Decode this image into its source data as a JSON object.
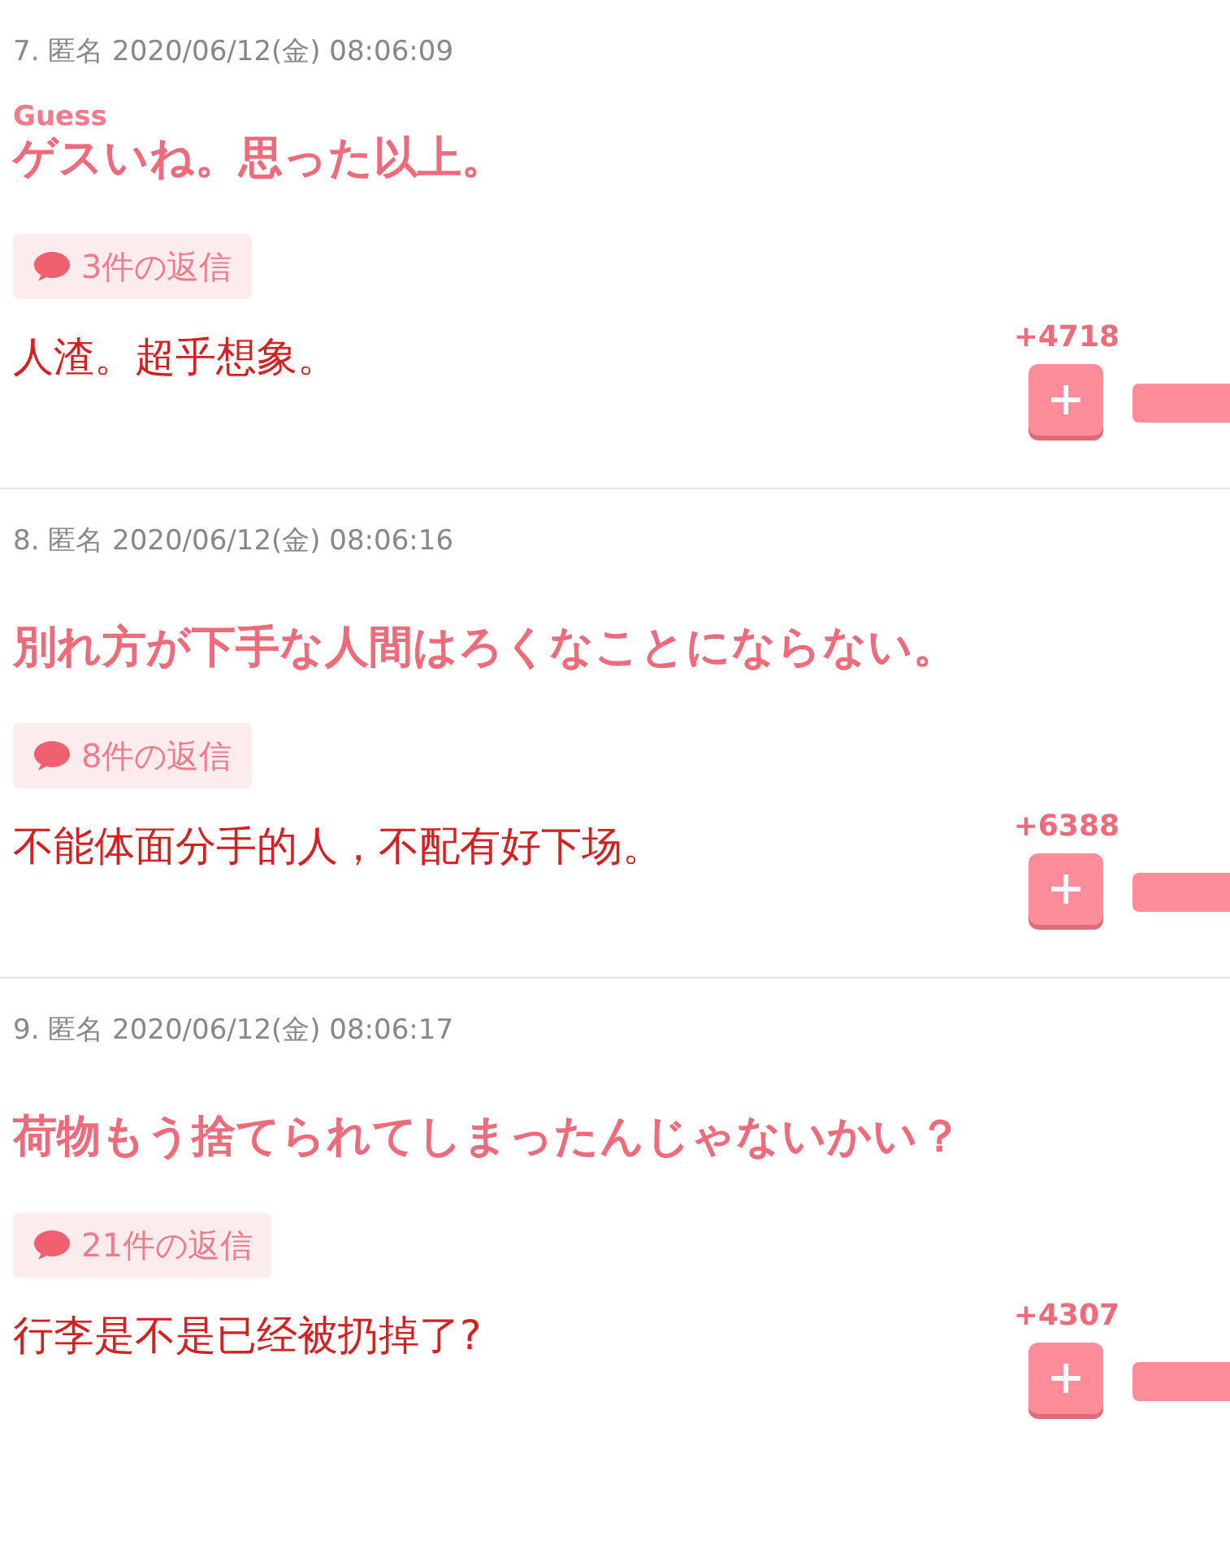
{
  "comments": [
    {
      "meta": "7. 匿名 2020/06/12(金) 08:06:09",
      "ruby": "Guess",
      "headline": "ゲスいね。思った以上。",
      "replies": "3件の返信",
      "translation": "人渣。超乎想象。",
      "votes": "+4718"
    },
    {
      "meta": "8. 匿名 2020/06/12(金) 08:06:16",
      "headline": "別れ方が下手な人間はろくなことにならない。",
      "replies": "8件の返信",
      "translation": "不能体面分手的人，不配有好下场。",
      "votes": "+6388"
    },
    {
      "meta": "9. 匿名 2020/06/12(金) 08:06:17",
      "headline": "荷物もう捨てられてしまったんじゃないかい？",
      "replies": "21件の返信",
      "translation": "行李是不是已经被扔掉了?",
      "votes": "+4307"
    }
  ]
}
